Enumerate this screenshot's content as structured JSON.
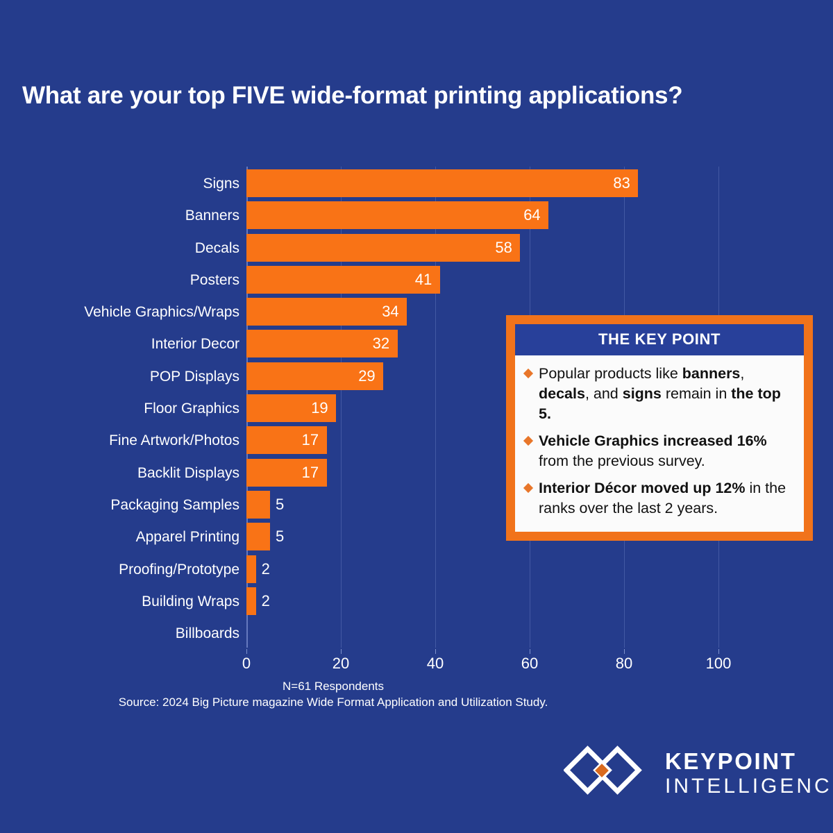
{
  "chart_data": {
    "type": "bar",
    "orientation": "horizontal",
    "title": "What are your top FIVE wide-format printing applications?",
    "xlabel": "",
    "ylabel": "",
    "xlim": [
      0,
      110
    ],
    "grid": true,
    "legend": "none",
    "categories": [
      "Signs",
      "Banners",
      "Decals",
      "Posters",
      "Vehicle Graphics/Wraps",
      "Interior Decor",
      "POP Displays",
      "Floor Graphics",
      "Fine Artwork/Photos",
      "Backlit Displays",
      "Packaging Samples",
      "Apparel Printing",
      "Proofing/Prototype",
      "Building Wraps",
      "Billboards"
    ],
    "values": [
      83,
      64,
      58,
      41,
      34,
      32,
      29,
      19,
      17,
      17,
      5,
      5,
      2,
      2,
      0
    ],
    "value_labels": [
      "83",
      "64",
      "58",
      "41",
      "34",
      "32",
      "29",
      "19",
      "17",
      "17",
      "5",
      "5",
      "2",
      "2",
      ""
    ],
    "xticks": [
      0,
      20,
      40,
      60,
      80,
      100
    ],
    "xtick_labels": [
      "0",
      "20",
      "40",
      "60",
      "80",
      "100"
    ],
    "bar_color": "#F97316",
    "background_color": "#253C8C"
  },
  "footnote": {
    "line1": "N=61 Respondents",
    "line2": "Source: 2024 Big Picture magazine Wide Format Application and Utilization Study."
  },
  "keypoint": {
    "header": "THE KEY POINT",
    "bullets": [
      {
        "parts": [
          {
            "text": "Popular products like ",
            "bold": false
          },
          {
            "text": "banners",
            "bold": true
          },
          {
            "text": ", ",
            "bold": false
          },
          {
            "text": "decals",
            "bold": true
          },
          {
            "text": ", and ",
            "bold": false
          },
          {
            "text": "signs",
            "bold": true
          },
          {
            "text": " remain in ",
            "bold": false
          },
          {
            "text": "the top 5.",
            "bold": true
          }
        ]
      },
      {
        "parts": [
          {
            "text": "Vehicle Graphics increased 16%",
            "bold": true
          },
          {
            "text": " from the previous survey.",
            "bold": false
          }
        ]
      },
      {
        "parts": [
          {
            "text": "Interior Décor moved up 12%",
            "bold": true
          },
          {
            "text": " in the ranks over the last 2 years.",
            "bold": false
          }
        ]
      }
    ]
  },
  "logo": {
    "line1": "KEYPOINT",
    "line2": "INTELLIGENCE"
  },
  "colors": {
    "background": "#253C8C",
    "bar": "#F97316",
    "callout_border": "#F1731B",
    "callout_header": "#28409A",
    "callout_body": "#FBFBFB",
    "text": "#FFFFFF",
    "gridline": "#4359A4"
  }
}
